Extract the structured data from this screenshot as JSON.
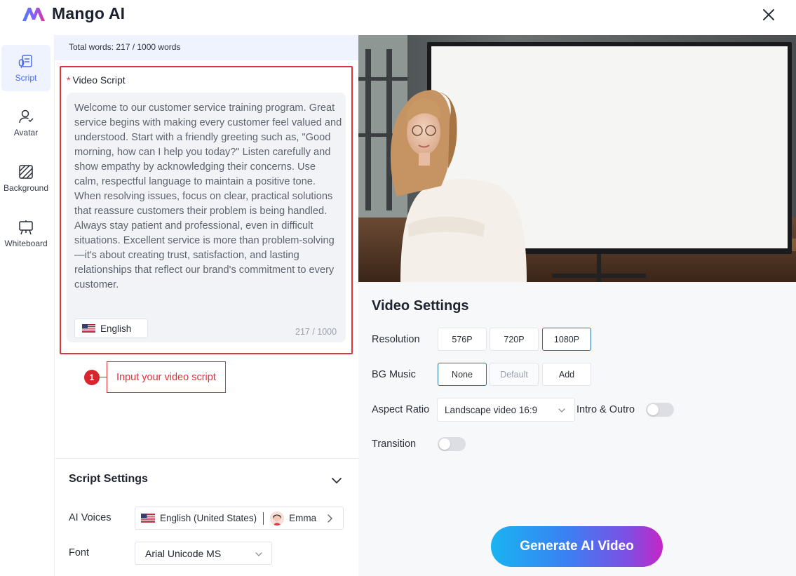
{
  "header": {
    "app_name": "Mango AI",
    "brand_colors": [
      "#4f7cf7",
      "#8b5cf6",
      "#e0328f"
    ]
  },
  "sidebar": {
    "items": [
      {
        "label": "Script",
        "icon": "script-icon",
        "active": true
      },
      {
        "label": "Avatar",
        "icon": "avatar-icon",
        "active": false
      },
      {
        "label": "Background",
        "icon": "background-icon",
        "active": false
      },
      {
        "label": "Whiteboard",
        "icon": "whiteboard-icon",
        "active": false
      }
    ]
  },
  "script": {
    "word_count": "Total words: 217 / 1000 words",
    "label": "Video Script",
    "required_mark": "*",
    "text": "Welcome to our customer service training program. Great service begins with making every customer feel valued and understood. Start with a friendly greeting such as, \"Good morning, how can I help you today?\" Listen carefully and show empathy by acknowledging their concerns. Use calm, respectful language to maintain a positive tone. When resolving issues, focus on clear, practical solutions that reassure customers their problem is being handled. Always stay patient and professional, even in difficult situations. Excellent service is more than problem-solving—it's about creating trust, satisfaction, and lasting relationships that reflect our brand's commitment to every customer.",
    "language": "English",
    "char_count": "217 / 1000",
    "hint_number": "1",
    "hint_text": "Input your video script"
  },
  "script_settings": {
    "title": "Script Settings",
    "ai_voices_label": "AI Voices",
    "voice_language": "English (United States)",
    "voice_name": "Emma",
    "font_label": "Font",
    "font_value": "Arial Unicode MS"
  },
  "video_settings": {
    "title": "Video Settings",
    "resolution_label": "Resolution",
    "resolutions": [
      {
        "label": "576P",
        "selected": false
      },
      {
        "label": "720P",
        "selected": false
      },
      {
        "label": "1080P",
        "selected": true
      }
    ],
    "bg_music_label": "BG Music",
    "bg_music_options": [
      {
        "label": "None",
        "selected": true,
        "disabled": false
      },
      {
        "label": "Default",
        "selected": false,
        "disabled": true
      },
      {
        "label": "Add",
        "selected": false,
        "disabled": false
      }
    ],
    "aspect_ratio_label": "Aspect Ratio",
    "aspect_ratio_value": "Landscape video 16:9",
    "intro_outro_label": "Intro & Outro",
    "intro_outro_on": false,
    "transition_label": "Transition",
    "transition_on": false,
    "generate_label": "Generate AI Video"
  }
}
